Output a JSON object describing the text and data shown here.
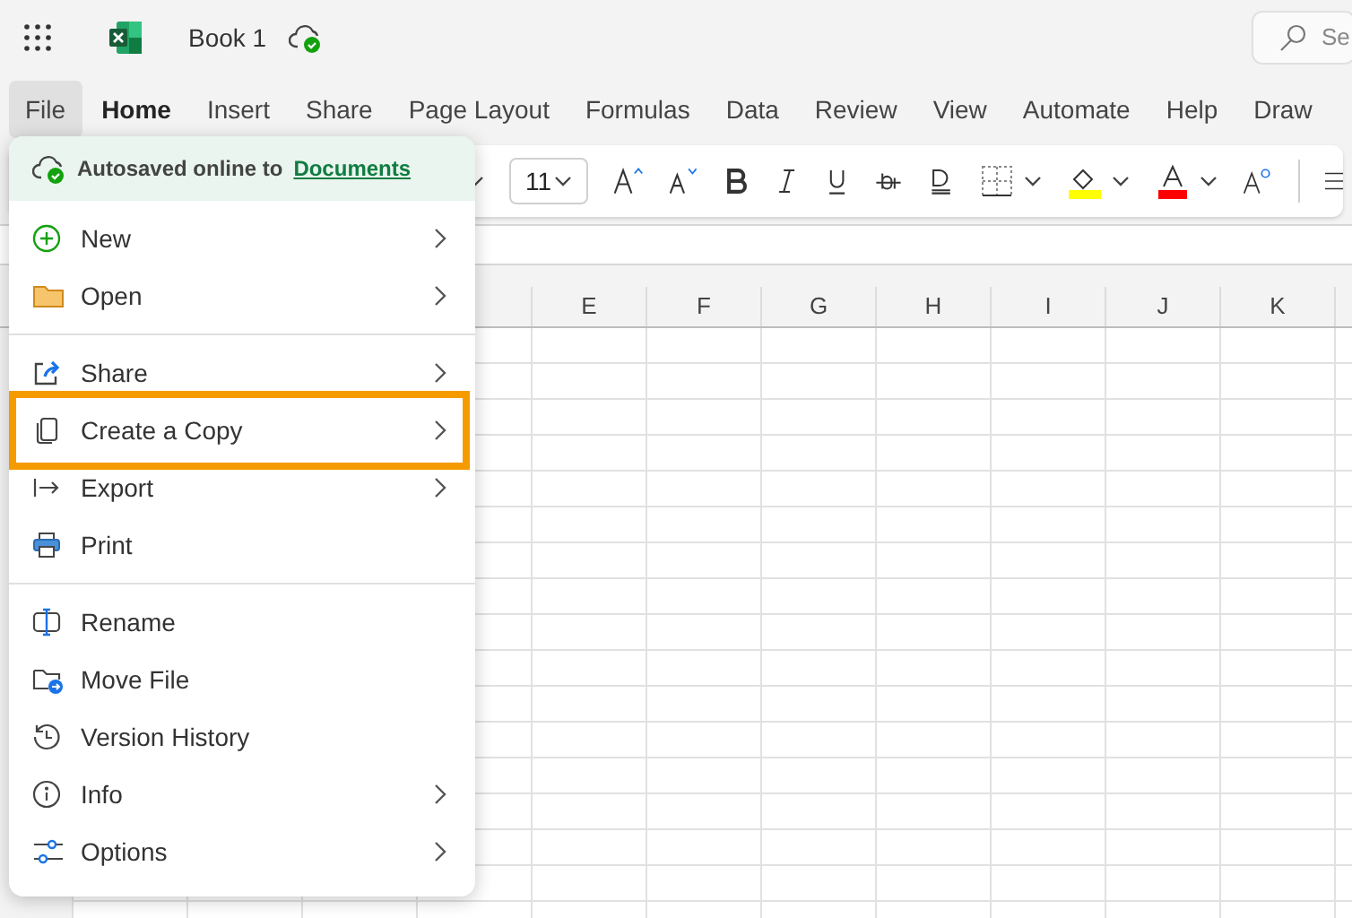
{
  "title_bar": {
    "document_title": "Book 1",
    "search": {
      "placeholder": "Se"
    }
  },
  "tabs": [
    {
      "label": "File",
      "selected": false,
      "pressed": true
    },
    {
      "label": "Home",
      "selected": true,
      "pressed": false
    },
    {
      "label": "Insert",
      "selected": false,
      "pressed": false
    },
    {
      "label": "Share",
      "selected": false,
      "pressed": false
    },
    {
      "label": "Page Layout",
      "selected": false,
      "pressed": false
    },
    {
      "label": "Formulas",
      "selected": false,
      "pressed": false
    },
    {
      "label": "Data",
      "selected": false,
      "pressed": false
    },
    {
      "label": "Review",
      "selected": false,
      "pressed": false
    },
    {
      "label": "View",
      "selected": false,
      "pressed": false
    },
    {
      "label": "Automate",
      "selected": false,
      "pressed": false
    },
    {
      "label": "Help",
      "selected": false,
      "pressed": false
    },
    {
      "label": "Draw",
      "selected": false,
      "pressed": false
    }
  ],
  "ribbon": {
    "font_size": "11"
  },
  "sheet": {
    "columns": [
      "E",
      "F",
      "G",
      "H",
      "I",
      "J",
      "K"
    ]
  },
  "file_menu": {
    "status": {
      "text": "Autosaved online to",
      "link": "Documents"
    },
    "groups": [
      [
        {
          "label": "New",
          "has_submenu": true,
          "highlighted": false
        },
        {
          "label": "Open",
          "has_submenu": true,
          "highlighted": false
        }
      ],
      [
        {
          "label": "Share",
          "has_submenu": true,
          "highlighted": false
        },
        {
          "label": "Create a Copy",
          "has_submenu": true,
          "highlighted": true
        },
        {
          "label": "Export",
          "has_submenu": true,
          "highlighted": false
        },
        {
          "label": "Print",
          "has_submenu": false,
          "highlighted": false
        }
      ],
      [
        {
          "label": "Rename",
          "has_submenu": false,
          "highlighted": false
        },
        {
          "label": "Move File",
          "has_submenu": false,
          "highlighted": false
        },
        {
          "label": "Version History",
          "has_submenu": false,
          "highlighted": false
        },
        {
          "label": "Info",
          "has_submenu": true,
          "highlighted": false
        },
        {
          "label": "Options",
          "has_submenu": true,
          "highlighted": false
        }
      ]
    ]
  }
}
